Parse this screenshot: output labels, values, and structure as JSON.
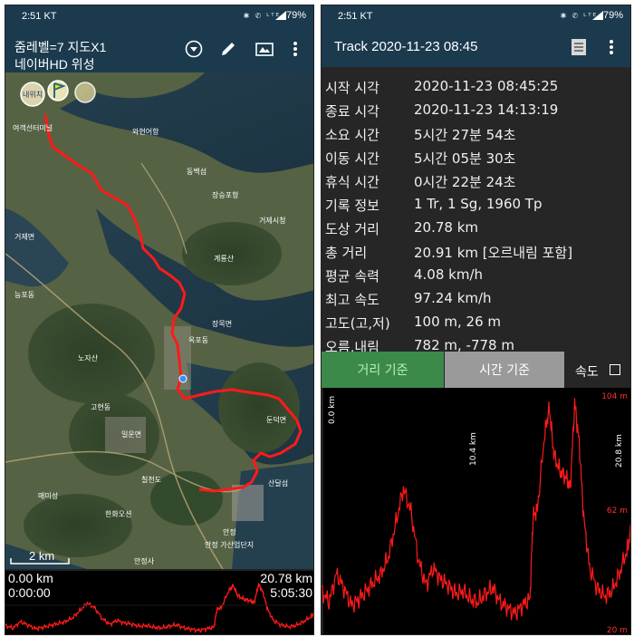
{
  "status": {
    "time": "2:51 KT",
    "battery": "79%",
    "icons": "✱ ✆ ᴸᵀᴱ"
  },
  "left": {
    "appbar": {
      "line1": "줌레벨=7 지도X1",
      "line2": "네이버HD 위성"
    },
    "map": {
      "labels": [
        "내위치",
        "여객선터미널",
        "와현어항",
        "동백섬",
        "장승포항",
        "거제시청",
        "계룡산",
        "노자산",
        "고현동",
        "능포동",
        "옥포동",
        "장목면",
        "거제면",
        "일운면",
        "둔덕면",
        "매미성",
        "산달섬",
        "칠천도",
        "한화오션",
        "안정",
        "안정사",
        "안정 가산업단지"
      ],
      "scale": "2 km"
    },
    "elevation": {
      "start_dist": "0.00 km",
      "start_time": "0:00:00",
      "end_dist": "20.78 km",
      "end_time": "5:05:30"
    }
  },
  "right": {
    "appbar": {
      "title": "Track 2020-11-23 08:45"
    },
    "rows": [
      {
        "label": "시작 시각",
        "value": "2020-11-23 08:45:25"
      },
      {
        "label": "종료 시각",
        "value": "2020-11-23 14:13:19"
      },
      {
        "label": "소요 시간",
        "value": "5시간 27분 54초"
      },
      {
        "label": "이동 시간",
        "value": "5시간 05분 30초"
      },
      {
        "label": "휴식 시간",
        "value": "0시간 22분 24초"
      },
      {
        "label": "기록 정보",
        "value": "1 Tr, 1 Sg, 1960 Tp"
      },
      {
        "label": "도상 거리",
        "value": "20.78 km"
      },
      {
        "label": "총 거리",
        "value": "20.91 km [오르내림 포함]"
      },
      {
        "label": "평균 속력",
        "value": "4.08 km/h"
      },
      {
        "label": "최고 속도",
        "value": "97.24 km/h"
      },
      {
        "label": "고도(고,저)",
        "value": "100 m, 26 m"
      },
      {
        "label": "오름,내림",
        "value": "782 m, -778 m"
      }
    ],
    "tabs": {
      "distance": "거리 기준",
      "time": "시간 기준",
      "speed": "속도"
    },
    "chart": {
      "y_labels": [
        "104 m",
        "62 m",
        "20 m"
      ],
      "x_labels": [
        "0.0 km",
        "10.4 km",
        "20.8 km"
      ]
    }
  },
  "colors": {
    "appbar": "#1b3a4e",
    "track": "#ff1a1a",
    "tab_active": "#3b8a4a",
    "tab_inactive": "#9a9a9a"
  },
  "chart_data": {
    "type": "line",
    "xlabel": "",
    "ylabel": "",
    "xlim": [
      0,
      20.8
    ],
    "ylim": [
      20,
      104
    ],
    "x": [
      0.0,
      0.5,
      1.0,
      1.5,
      2.0,
      2.5,
      3.0,
      3.5,
      4.0,
      4.5,
      5.0,
      5.5,
      6.0,
      6.5,
      7.0,
      7.5,
      8.0,
      8.5,
      9.0,
      9.5,
      10.0,
      10.5,
      11.0,
      11.5,
      12.0,
      12.5,
      13.0,
      13.5,
      14.0,
      14.2,
      14.5,
      15.0,
      15.3,
      15.6,
      16.0,
      16.4,
      16.7,
      17.0,
      17.3,
      17.6,
      18.0,
      18.5,
      19.0,
      19.5,
      20.0,
      20.5,
      20.78
    ],
    "y": [
      34,
      30,
      40,
      35,
      29,
      31,
      34,
      37,
      40,
      46,
      58,
      70,
      62,
      45,
      36,
      42,
      38,
      36,
      33,
      34,
      31,
      30,
      33,
      35,
      30,
      28,
      26,
      29,
      31,
      60,
      63,
      90,
      98,
      82,
      76,
      74,
      70,
      100,
      86,
      60,
      42,
      35,
      32,
      34,
      40,
      48,
      55
    ]
  }
}
